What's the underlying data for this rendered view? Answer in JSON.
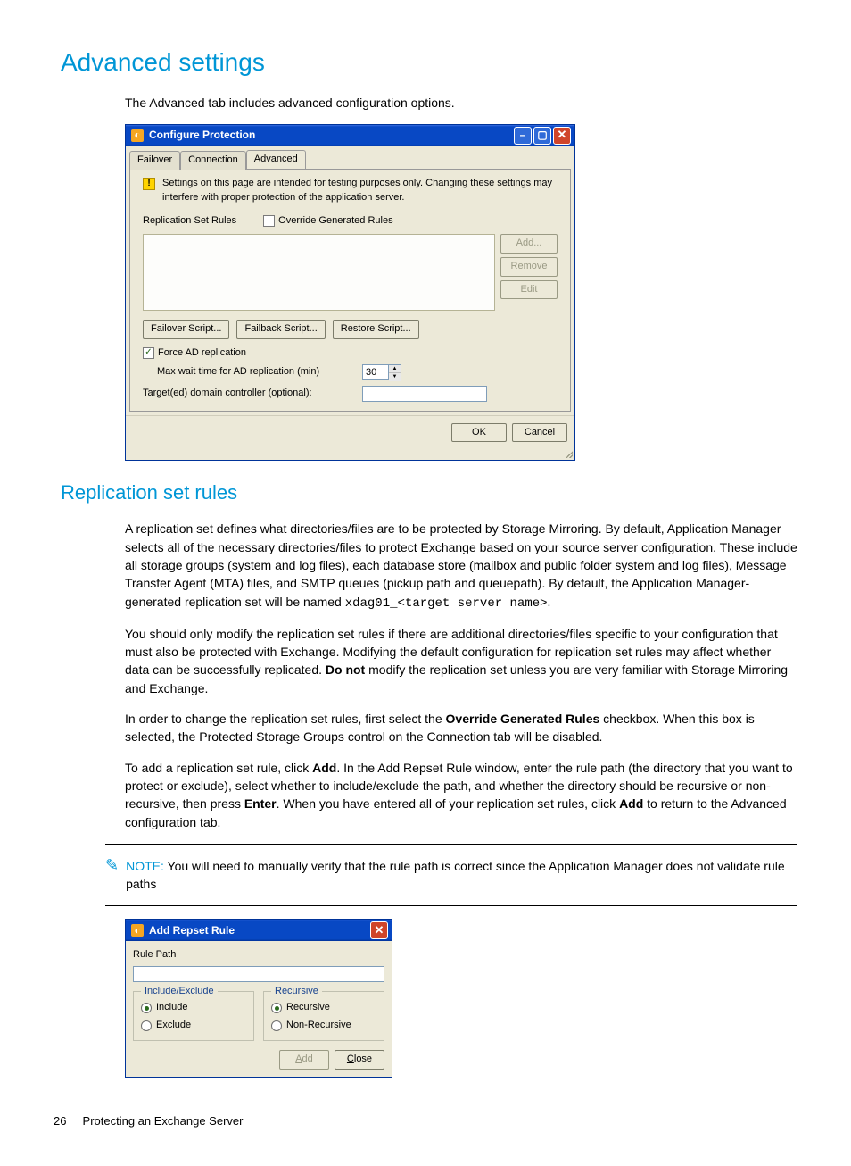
{
  "headings": {
    "advanced_settings": "Advanced settings",
    "replication_set_rules": "Replication set rules"
  },
  "intro_text": "The Advanced tab includes advanced configuration options.",
  "config_window": {
    "title": "Configure Protection",
    "tabs": {
      "failover": "Failover",
      "connection": "Connection",
      "advanced": "Advanced"
    },
    "warning": "Settings on this page are intended for testing purposes only.  Changing these settings may interfere with proper protection of the application server.",
    "rules_label": "Replication Set Rules",
    "override_label": "Override Generated Rules",
    "buttons": {
      "add": "Add...",
      "remove": "Remove",
      "edit": "Edit"
    },
    "scripts": {
      "failover": "Failover Script...",
      "failback": "Failback Script...",
      "restore": "Restore Script..."
    },
    "force_ad": "Force AD replication",
    "max_wait_label": "Max wait time for AD replication (min)",
    "max_wait_value": "30",
    "targeted_dc_label": "Target(ed) domain controller (optional):",
    "ok": "OK",
    "cancel": "Cancel"
  },
  "body_paragraphs": {
    "p1_a": "A replication set defines what directories/files are to be protected by Storage Mirroring. By default, Application Manager selects all of the necessary directories/files to protect Exchange based on your source server configuration. These include all storage groups (system and log files), each database store (mailbox and public folder system and log files), Message Transfer Agent (MTA) files, and SMTP queues (pickup path and queuepath). By default, the Application Manager-generated replication set will be named ",
    "p1_code": "xdag01_<target server name>",
    "p1_b": ".",
    "p2_a": "You should only modify the replication set rules if there are additional directories/files specific to your configuration that must also be protected with Exchange. Modifying the default configuration for replication set rules may affect whether data can be successfully replicated. ",
    "p2_bold": "Do not",
    "p2_b": " modify the replication set unless you are very familiar with Storage Mirroring and Exchange.",
    "p3_a": "In order to change the replication set rules, first select the ",
    "p3_bold": "Override Generated Rules",
    "p3_b": " checkbox. When this box is selected, the Protected Storage Groups control on the Connection tab will be disabled.",
    "p4_a": "To add a replication set rule, click ",
    "p4_bold1": "Add",
    "p4_b": ". In the Add Repset Rule window, enter the rule path (the directory that you want to protect or exclude), select whether to include/exclude the path, and whether the directory should be recursive or non-recursive, then press ",
    "p4_bold2": "Enter",
    "p4_c": ". When you have entered all of your replication set rules, click ",
    "p4_bold3": "Add",
    "p4_d": " to return to the Advanced configuration tab."
  },
  "note": {
    "label": "NOTE:",
    "text": "You will need to manually verify that the rule path is correct since the Application Manager does not validate rule paths"
  },
  "repset_window": {
    "title": "Add Repset Rule",
    "rule_path_label": "Rule Path",
    "include_exclude": {
      "legend": "Include/Exclude",
      "include": "Include",
      "exclude": "Exclude"
    },
    "recursive": {
      "legend": "Recursive",
      "recursive": "Recursive",
      "non_recursive": "Non-Recursive"
    },
    "add": "Add",
    "close": "Close"
  },
  "footer": {
    "page_num": "26",
    "chapter": "Protecting an Exchange Server"
  }
}
